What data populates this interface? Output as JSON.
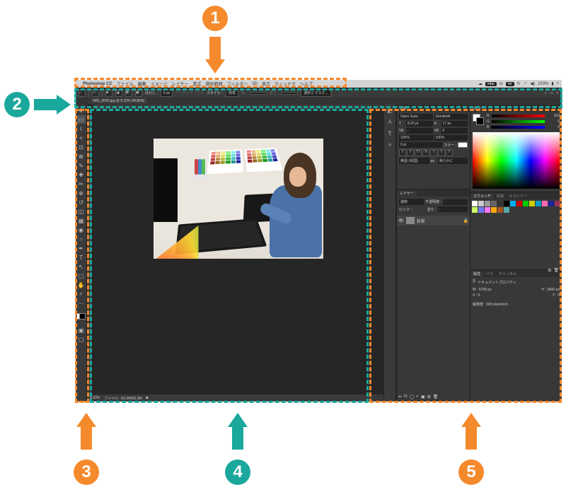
{
  "annotations": {
    "n1": "1",
    "n2": "2",
    "n3": "3",
    "n4": "4",
    "n5": "5"
  },
  "menubar": {
    "app": "Photoshop CC",
    "items": [
      "ファイル",
      "編集",
      "イメージ",
      "レイヤー",
      "書式",
      "選択範囲",
      "フィルター",
      "3D",
      "表示",
      "ウィンドウ",
      "ヘルプ"
    ],
    "right": {
      "badges": [
        "mbp",
        "mr"
      ],
      "wifi": "⌔",
      "volume": "◀)",
      "percent": "100%",
      "search": "⌕"
    }
  },
  "optionsbar": {
    "home": "⌂",
    "feather_label": "ぼかし :",
    "feather_value": "0 px",
    "antialias": "アンチエイリアス",
    "style_label": "スタイル :",
    "style_value": "標準",
    "width_label": "幅 :",
    "height_label": "高さ :",
    "mask_btn": "選択とマスク..."
  },
  "document": {
    "tab": "IMG_0000.jpg @ 8.33% (RGB/8)",
    "zoom": "8.33%",
    "file_info": "ファイル : 63.3M/63.3M"
  },
  "statusbar_tip": "▶",
  "panels": {
    "char": {
      "tab": "文字",
      "font": "Open Sans",
      "style": "Semibold",
      "size": "8.25 pt",
      "size_ic": "T",
      "leading": "17 px",
      "leading_ic": "A",
      "tracking": "VA",
      "tracking_val": "0",
      "kerning": "VA",
      "kerning_val": "-",
      "scale_v": "100%",
      "scale_h": "100%",
      "baseline": "0 pt",
      "color_label": "カラー :",
      "style_btns": [
        "T",
        "T",
        "TT",
        "Tr",
        "T",
        "T",
        "T"
      ],
      "lang_label": "英語 (米国)",
      "aa_label": "aa",
      "aa_val": "滑らかに"
    },
    "layers": {
      "tab": "レイヤー",
      "blend": "通常",
      "opacity_label": "不透明度 :",
      "opacity": "-",
      "lock_label": "ロック :",
      "fill_label": "塗り :",
      "fill": "-",
      "bg_layer": "背景"
    },
    "color": {
      "tab": "カラー",
      "r": "100",
      "g": "0",
      "b": "0",
      "labels": [
        "R",
        "G",
        "B"
      ]
    },
    "swatch": {
      "tabs": [
        "スウォッチ",
        "段落",
        "ヒストリー"
      ]
    },
    "properties": {
      "tabs": [
        "属性",
        "パス",
        "チャンネル"
      ],
      "doc": "ドキュメントプロパティ",
      "w_label": "W :",
      "w": "5760 px",
      "h_label": "H :",
      "h": "3840 px",
      "x_label": "X :",
      "x": "0",
      "y_label": "Y :",
      "y": "0",
      "res_label": "解像度 :",
      "res": "300 pixel/inch"
    }
  },
  "swatch_colors": [
    "#fff",
    "#ccc",
    "#999",
    "#666",
    "#333",
    "#000",
    "#00aeef",
    "#c00",
    "#0c0",
    "#cc0",
    "#09c",
    "#ff69b4",
    "#229",
    "#935",
    "#cf6",
    "#77f",
    "#f7f",
    "#fa0",
    "#a52",
    "#5aa"
  ],
  "sheet_colors": [
    "#e88",
    "#eb8",
    "#ee8",
    "#8e8",
    "#8ee",
    "#88e",
    "#d66",
    "#da6",
    "#dd6",
    "#6d6",
    "#6dd",
    "#66d",
    "#b44",
    "#b84",
    "#bb4",
    "#4b4",
    "#4bb",
    "#44b",
    "#922",
    "#962",
    "#992",
    "#292",
    "#299",
    "#229"
  ]
}
